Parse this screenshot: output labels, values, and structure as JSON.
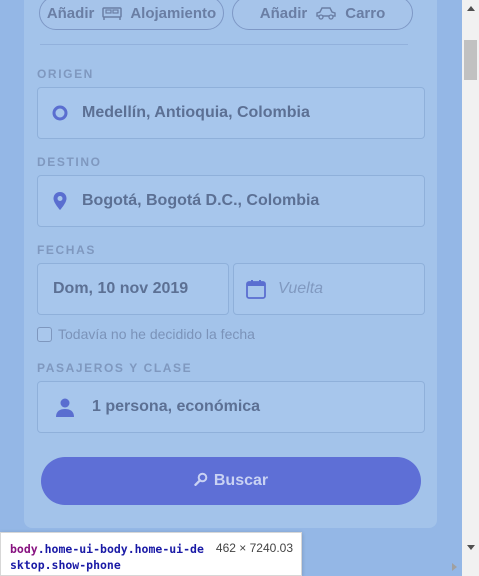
{
  "addons": {
    "lodging": {
      "label_prefix": "Añadir",
      "label": "Alojamiento",
      "icon": "bed-icon"
    },
    "car": {
      "label_prefix": "Añadir",
      "label": "Carro",
      "icon": "car-icon"
    }
  },
  "origin": {
    "section_label": "ORIGEN",
    "value": "Medellín, Antioquia, Colombia",
    "icon": "circle-icon"
  },
  "destination": {
    "section_label": "DESTINO",
    "value": "Bogotá, Bogotá D.C., Colombia",
    "icon": "map-pin-icon"
  },
  "dates": {
    "section_label": "FECHAS",
    "departure_value": "Dom, 10 nov 2019",
    "return_placeholder": "Vuelta",
    "undecided_label": "Todavía no he decidido la fecha"
  },
  "passengers": {
    "section_label": "PASAJEROS Y CLASE",
    "value": "1 persona, económica",
    "icon": "person-icon"
  },
  "search_button": {
    "label": "Buscar",
    "icon": "search-icon"
  },
  "devtools_tooltip": {
    "tag": "body",
    "selector": ".home-ui-body.home-ui-desktop.show-phone",
    "dimensions": "462 × 7240.03"
  },
  "colors": {
    "accent": "#5e6fd6",
    "card_bg": "#a3c3ea",
    "page_bg": "#94b7e6"
  }
}
